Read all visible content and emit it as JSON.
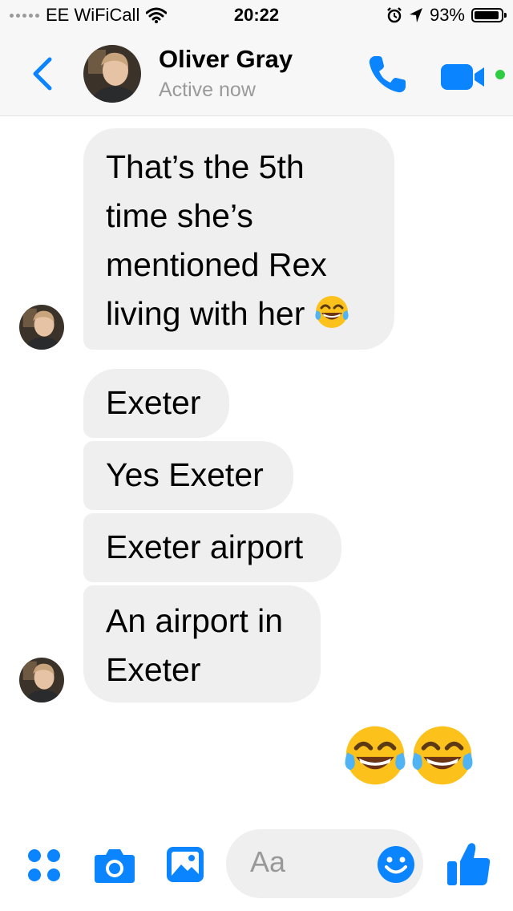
{
  "status_bar": {
    "carrier": "EE WiFiCall",
    "time": "20:22",
    "battery": "93%",
    "battery_level": 0.93
  },
  "header": {
    "name": "Oliver Gray",
    "status": "Active now"
  },
  "messages": [
    {
      "text": "That’s the 5th time she’s mentioned Rex living with her",
      "emoji": "face-with-tears-of-joy"
    },
    {
      "text": "Exeter"
    },
    {
      "text": "Yes Exeter"
    },
    {
      "text": "Exeter airport"
    },
    {
      "text": "An airport in Exeter"
    }
  ],
  "sent_message": {
    "emojis": [
      "face-with-tears-of-joy",
      "face-with-tears-of-joy"
    ]
  },
  "composer": {
    "placeholder": "Aa"
  },
  "colors": {
    "accent": "#0a84ff",
    "bubble_received": "#efefef",
    "online": "#2ecc40"
  }
}
